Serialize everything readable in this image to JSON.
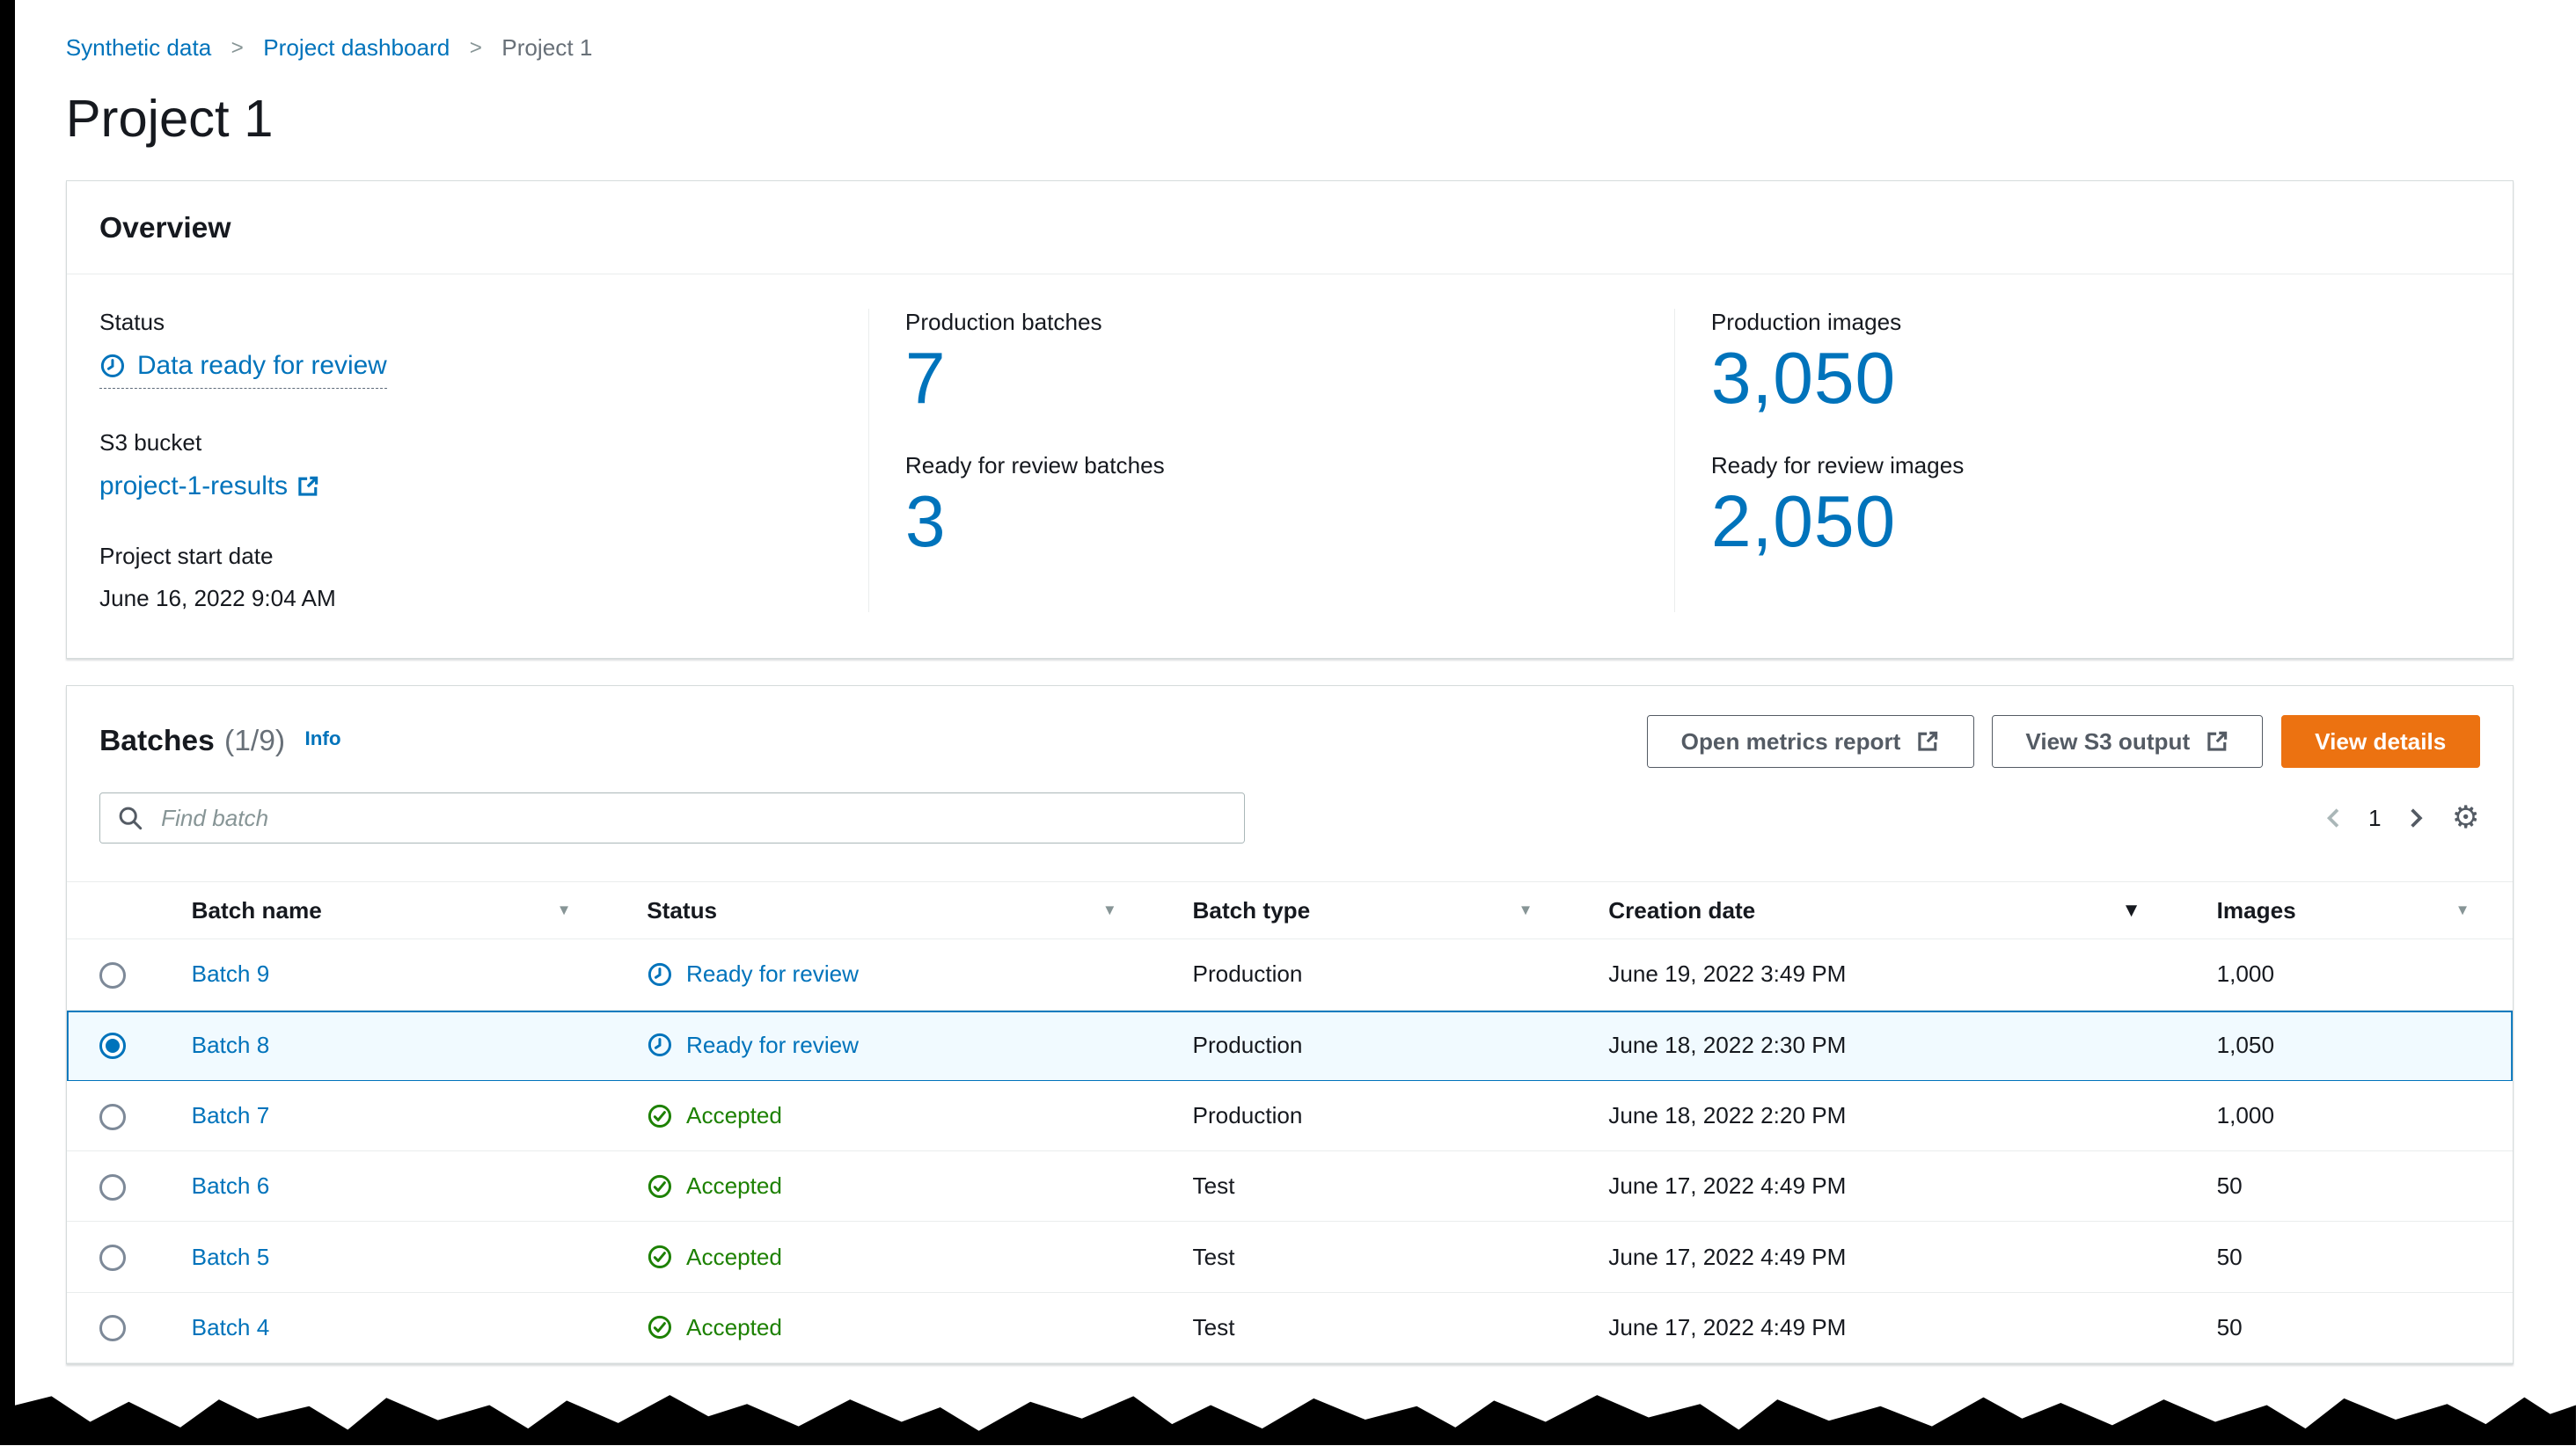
{
  "breadcrumb": {
    "items": [
      {
        "label": "Synthetic data"
      },
      {
        "label": "Project dashboard"
      },
      {
        "label": "Project 1"
      }
    ]
  },
  "page": {
    "title": "Project 1"
  },
  "overview": {
    "title": "Overview",
    "status": {
      "label": "Status",
      "value": "Data ready for review"
    },
    "s3": {
      "label": "S3 bucket",
      "value": "project-1-results"
    },
    "start": {
      "label": "Project start date",
      "value": "June 16, 2022 9:04 AM"
    },
    "stats": [
      {
        "label": "Production batches",
        "value": "7"
      },
      {
        "label": "Ready for review batches",
        "value": "3"
      },
      {
        "label": "Production images",
        "value": "3,050"
      },
      {
        "label": "Ready for review images",
        "value": "2,050"
      }
    ]
  },
  "batches": {
    "title": "Batches",
    "counter": "(1/9)",
    "info_label": "Info",
    "buttons": {
      "metrics": "Open metrics report",
      "s3_output": "View S3 output",
      "details": "View details"
    },
    "search_placeholder": "Find batch",
    "pagination": {
      "page": "1"
    },
    "table": {
      "columns": [
        "Batch name",
        "Status",
        "Batch type",
        "Creation date",
        "Images"
      ],
      "rows": [
        {
          "name": "Batch 9",
          "status": "Ready for review",
          "type": "Production",
          "date": "June 19, 2022 3:49 PM",
          "images": "1,000",
          "selected": false
        },
        {
          "name": "Batch 8",
          "status": "Ready for review",
          "type": "Production",
          "date": "June 18, 2022 2:30 PM",
          "images": "1,050",
          "selected": true
        },
        {
          "name": "Batch 7",
          "status": "Accepted",
          "type": "Production",
          "date": "June 18, 2022 2:20 PM",
          "images": "1,000",
          "selected": false
        },
        {
          "name": "Batch 6",
          "status": "Accepted",
          "type": "Test",
          "date": "June 17, 2022 4:49 PM",
          "images": "50",
          "selected": false
        },
        {
          "name": "Batch 5",
          "status": "Accepted",
          "type": "Test",
          "date": "June 17, 2022 4:49 PM",
          "images": "50",
          "selected": false
        },
        {
          "name": "Batch 4",
          "status": "Accepted",
          "type": "Test",
          "date": "June 17, 2022 4:49 PM",
          "images": "50",
          "selected": false
        }
      ]
    }
  },
  "icons": {
    "settings_glyph": "⚙"
  },
  "colors": {
    "link_blue": "#0073bb",
    "primary_orange": "#ec7211",
    "success_green": "#1d8102",
    "border_gray": "#d5dbdb"
  }
}
